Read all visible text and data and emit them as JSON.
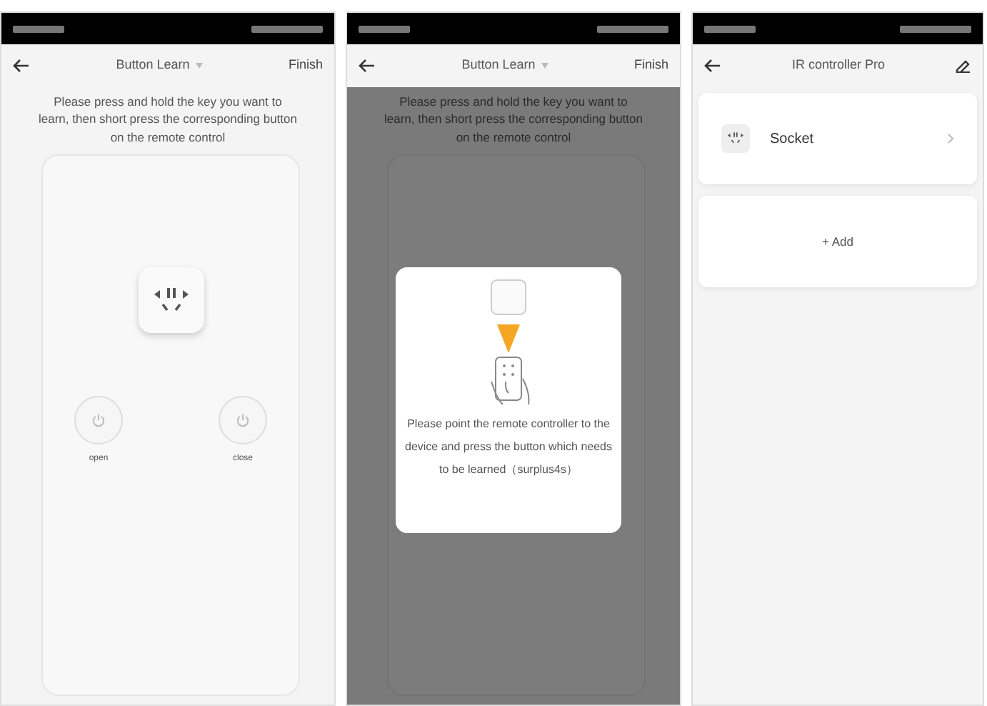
{
  "screens": [
    {
      "kind": "learn",
      "header": {
        "title": "Button Learn",
        "action": "Finish"
      },
      "instruction": "Please press and hold the key you want to learn, then short press the corresponding button on the remote control",
      "keys": [
        {
          "label": "open"
        },
        {
          "label": "close"
        }
      ]
    },
    {
      "kind": "learn",
      "header": {
        "title": "Button Learn",
        "action": "Finish"
      },
      "instruction": "Please press and hold the key you want to learn, then short press the corresponding button on the remote control",
      "dialog": {
        "text": "Please point the remote controller to the device and press the button which needs to be learned（surplus4s）"
      }
    },
    {
      "kind": "devices",
      "header": {
        "title": "IR controller Pro"
      },
      "devices": [
        {
          "name": "Socket"
        }
      ],
      "add_label": "+ Add"
    }
  ]
}
